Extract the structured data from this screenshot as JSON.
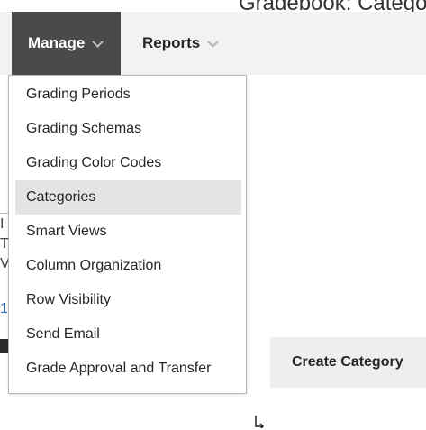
{
  "background": {
    "clipped_heading": "Gradebook: Category (",
    "edge_items": [
      {
        "text": "I"
      },
      {
        "text": "T"
      },
      {
        "text": "V"
      },
      {
        "text": "1"
      }
    ]
  },
  "toolbar": {
    "manage_label": "Manage",
    "reports_label": "Reports"
  },
  "manage_menu": {
    "items": [
      {
        "label": "Grading Periods"
      },
      {
        "label": "Grading Schemas"
      },
      {
        "label": "Grading Color Codes"
      },
      {
        "label": "Categories"
      },
      {
        "label": "Smart Views"
      },
      {
        "label": "Column Organization"
      },
      {
        "label": "Row Visibility"
      },
      {
        "label": "Send Email"
      },
      {
        "label": "Grade Approval and Transfer"
      }
    ],
    "selected": "Categories"
  },
  "actions": {
    "create_category_label": "Create Category"
  },
  "colors": {
    "manage_tab_bg": "#4a4a4a",
    "action_bar_bg": "#f2f2f2",
    "selected_item_bg": "#e4e4e4",
    "link": "#2a6ebb"
  },
  "icons": {
    "manage_chevron": "chevron-down-icon",
    "reports_chevron": "chevron-down-icon",
    "cursor": "pointer-cursor-icon"
  }
}
